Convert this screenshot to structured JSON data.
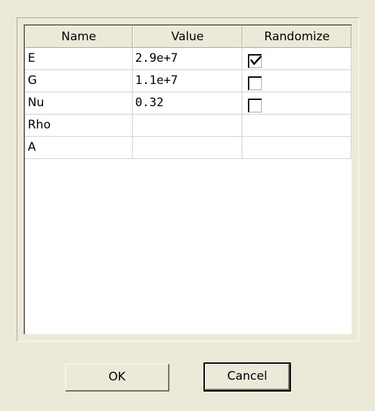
{
  "table": {
    "headers": {
      "name": "Name",
      "value": "Value",
      "randomize": "Randomize"
    },
    "rows": [
      {
        "name": "E",
        "value": "2.9e+7",
        "randomize": "checked"
      },
      {
        "name": "G",
        "value": "1.1e+7",
        "randomize": "unchecked"
      },
      {
        "name": "Nu",
        "value": "0.32",
        "randomize": "unchecked"
      },
      {
        "name": "Rho",
        "value": "",
        "randomize": "none"
      },
      {
        "name": "A",
        "value": "",
        "randomize": "none"
      }
    ]
  },
  "buttons": {
    "ok_label": "OK",
    "cancel_label": "Cancel"
  },
  "colors": {
    "dialog_background": "#ECE9D8",
    "table_background": "#FFFFFF",
    "grid_line": "#D4D0C8"
  },
  "icons": {
    "checkmark": "checkmark-icon"
  }
}
